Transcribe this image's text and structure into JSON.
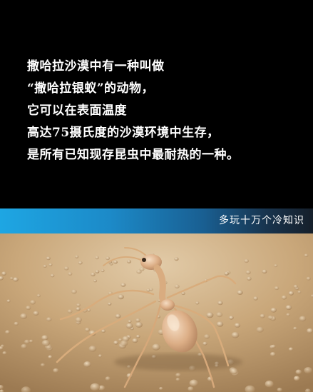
{
  "caption": {
    "lines": [
      "撒哈拉沙漠中有一种叫做",
      "“撒哈拉银蚁”的动物，",
      "它可以在表面温度",
      "高达75摄氏度的沙漠环境中生存，",
      "是所有已知现存昆虫中最耐热的一种。"
    ]
  },
  "banner": {
    "label": "多玩十万个冷知识"
  },
  "colors": {
    "background": "#000000",
    "caption_text": "#ffffff",
    "banner_start": "#1ea6e3",
    "banner_end": "#161f2a",
    "sand": "#c9a97e",
    "ant_body": "#e0b68f"
  },
  "photo": {
    "icon": "silver-ant-photo"
  }
}
